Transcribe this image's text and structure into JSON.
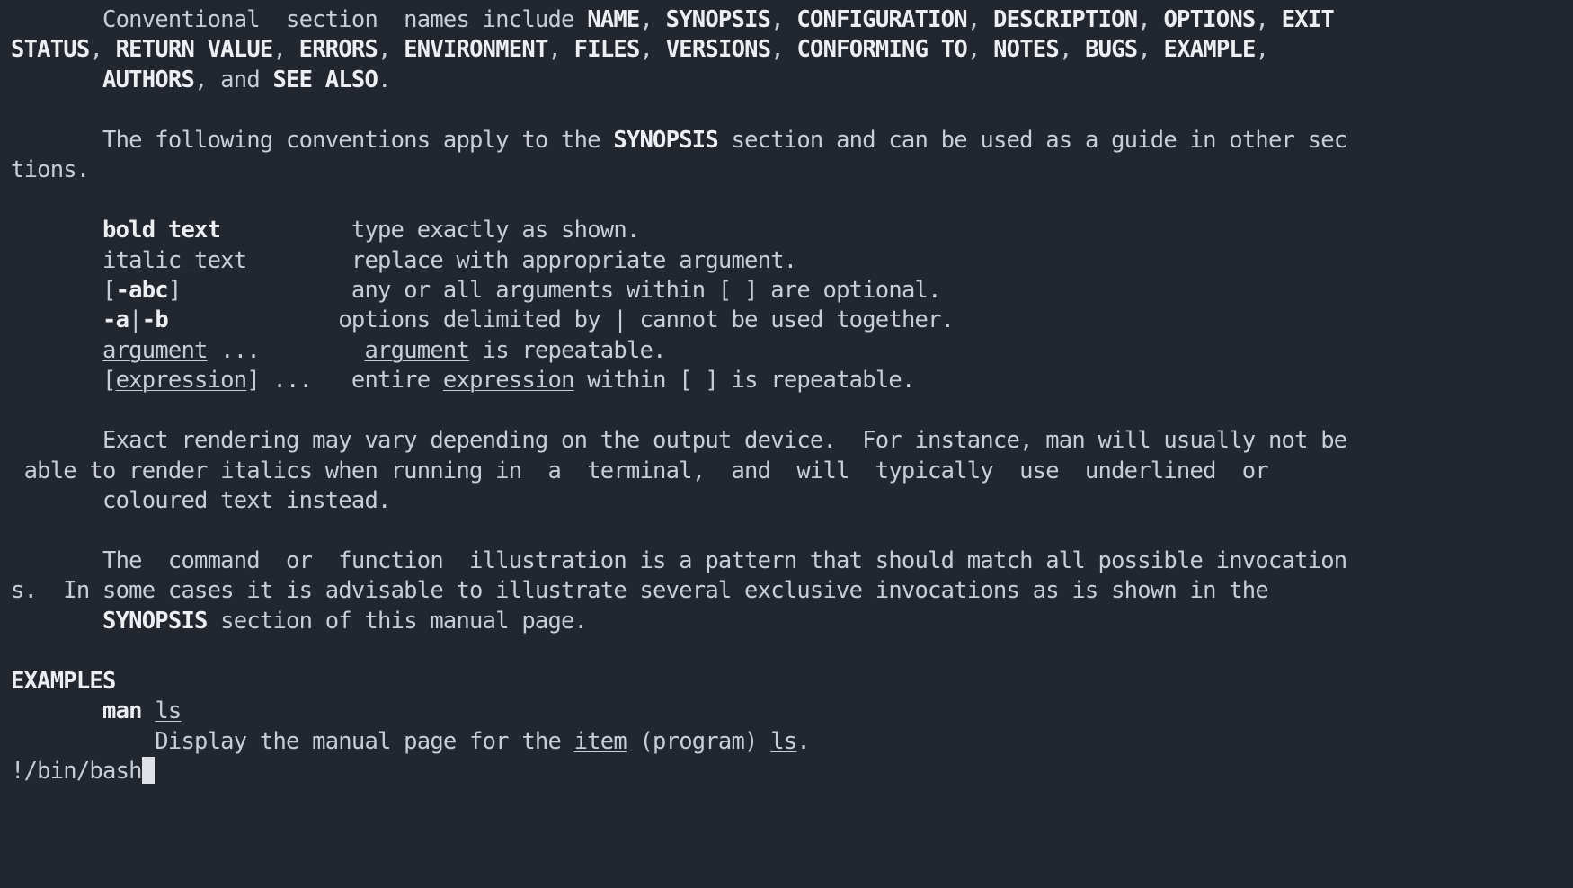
{
  "terminal": {
    "background_color": "#22262e",
    "foreground_color": "#c9cdd5",
    "bold_color": "#eceef2",
    "cursor_color": "#dfe1e6",
    "title": "man man"
  },
  "lines": [
    {
      "id": "conventional-section-names-1",
      "segments": [
        {
          "style": "normal",
          "text": "       Conventional  section  names include "
        },
        {
          "style": "bold",
          "text": "NAME"
        },
        {
          "style": "normal",
          "text": ", "
        },
        {
          "style": "bold",
          "text": "SYNOPSIS"
        },
        {
          "style": "normal",
          "text": ", "
        },
        {
          "style": "bold",
          "text": "CONFIGURATION"
        },
        {
          "style": "normal",
          "text": ", "
        },
        {
          "style": "bold",
          "text": "DESCRIPTION"
        },
        {
          "style": "normal",
          "text": ", "
        },
        {
          "style": "bold",
          "text": "OPTIONS"
        },
        {
          "style": "normal",
          "text": ", "
        },
        {
          "style": "bold",
          "text": "EXIT"
        }
      ]
    },
    {
      "id": "conventional-section-names-2",
      "segments": [
        {
          "style": "bold",
          "text": "STATUS"
        },
        {
          "style": "normal",
          "text": ", "
        },
        {
          "style": "bold",
          "text": "RETURN VALUE"
        },
        {
          "style": "normal",
          "text": ", "
        },
        {
          "style": "bold",
          "text": "ERRORS"
        },
        {
          "style": "normal",
          "text": ", "
        },
        {
          "style": "bold",
          "text": "ENVIRONMENT"
        },
        {
          "style": "normal",
          "text": ", "
        },
        {
          "style": "bold",
          "text": "FILES"
        },
        {
          "style": "normal",
          "text": ", "
        },
        {
          "style": "bold",
          "text": "VERSIONS"
        },
        {
          "style": "normal",
          "text": ", "
        },
        {
          "style": "bold",
          "text": "CONFORMING TO"
        },
        {
          "style": "normal",
          "text": ", "
        },
        {
          "style": "bold",
          "text": "NOTES"
        },
        {
          "style": "normal",
          "text": ", "
        },
        {
          "style": "bold",
          "text": "BUGS"
        },
        {
          "style": "normal",
          "text": ", "
        },
        {
          "style": "bold",
          "text": "EXAMPLE"
        },
        {
          "style": "normal",
          "text": ","
        }
      ]
    },
    {
      "id": "conventional-section-names-3",
      "segments": [
        {
          "style": "normal",
          "text": "       "
        },
        {
          "style": "bold",
          "text": "AUTHORS"
        },
        {
          "style": "normal",
          "text": ", and "
        },
        {
          "style": "bold",
          "text": "SEE ALSO"
        },
        {
          "style": "normal",
          "text": "."
        }
      ]
    },
    {
      "id": "blank-1",
      "segments": [
        {
          "style": "normal",
          "text": ""
        }
      ]
    },
    {
      "id": "conventions-intro-1",
      "segments": [
        {
          "style": "normal",
          "text": "       The following conventions apply to the "
        },
        {
          "style": "bold",
          "text": "SYNOPSIS"
        },
        {
          "style": "normal",
          "text": " section and can be used as a guide in other sec"
        }
      ]
    },
    {
      "id": "conventions-intro-2",
      "segments": [
        {
          "style": "normal",
          "text": "tions."
        }
      ]
    },
    {
      "id": "blank-2",
      "segments": [
        {
          "style": "normal",
          "text": ""
        }
      ]
    },
    {
      "id": "convention-bold-text",
      "segments": [
        {
          "style": "normal",
          "text": "       "
        },
        {
          "style": "bold",
          "text": "bold text"
        },
        {
          "style": "normal",
          "text": "          type exactly as shown."
        }
      ]
    },
    {
      "id": "convention-italic-text",
      "segments": [
        {
          "style": "normal",
          "text": "       "
        },
        {
          "style": "underline",
          "text": "italic text"
        },
        {
          "style": "normal",
          "text": "        replace with appropriate argument."
        }
      ]
    },
    {
      "id": "convention-optional-args",
      "segments": [
        {
          "style": "normal",
          "text": "       ["
        },
        {
          "style": "bold",
          "text": "-abc"
        },
        {
          "style": "normal",
          "text": "]             any or all arguments within [ ] are optional."
        }
      ]
    },
    {
      "id": "convention-delimited-options",
      "segments": [
        {
          "style": "normal",
          "text": "       "
        },
        {
          "style": "bold",
          "text": "-a"
        },
        {
          "style": "normal",
          "text": "|"
        },
        {
          "style": "bold",
          "text": "-b"
        },
        {
          "style": "normal",
          "text": "             options delimited by | cannot be used together."
        }
      ]
    },
    {
      "id": "convention-repeatable-argument",
      "segments": [
        {
          "style": "normal",
          "text": "       "
        },
        {
          "style": "underline",
          "text": "argument"
        },
        {
          "style": "normal",
          "text": " ...        "
        },
        {
          "style": "underline",
          "text": "argument"
        },
        {
          "style": "normal",
          "text": " is repeatable."
        }
      ]
    },
    {
      "id": "convention-repeatable-expression",
      "segments": [
        {
          "style": "normal",
          "text": "       ["
        },
        {
          "style": "underline",
          "text": "expression"
        },
        {
          "style": "normal",
          "text": "] ...   entire "
        },
        {
          "style": "underline",
          "text": "expression"
        },
        {
          "style": "normal",
          "text": " within [ ] is repeatable."
        }
      ]
    },
    {
      "id": "blank-3",
      "segments": [
        {
          "style": "normal",
          "text": ""
        }
      ]
    },
    {
      "id": "exact-rendering-1",
      "segments": [
        {
          "style": "normal",
          "text": "       Exact rendering may vary depending on the output device.  For instance, man will usually not be"
        }
      ]
    },
    {
      "id": "exact-rendering-2",
      "segments": [
        {
          "style": "normal",
          "text": " able to render italics when running in  a  terminal,  and  will  typically  use  underlined  or"
        }
      ]
    },
    {
      "id": "exact-rendering-3",
      "segments": [
        {
          "style": "normal",
          "text": "       coloured text instead."
        }
      ]
    },
    {
      "id": "blank-4",
      "segments": [
        {
          "style": "normal",
          "text": ""
        }
      ]
    },
    {
      "id": "command-illustration-1",
      "segments": [
        {
          "style": "normal",
          "text": "       The  command  or  function  illustration is a pattern that should match all possible invocation"
        }
      ]
    },
    {
      "id": "command-illustration-2",
      "segments": [
        {
          "style": "normal",
          "text": "s.  In some cases it is advisable to illustrate several exclusive invocations as is shown in the"
        }
      ]
    },
    {
      "id": "command-illustration-3",
      "segments": [
        {
          "style": "normal",
          "text": "       "
        },
        {
          "style": "bold",
          "text": "SYNOPSIS"
        },
        {
          "style": "normal",
          "text": " section of this manual page."
        }
      ]
    },
    {
      "id": "blank-5",
      "segments": [
        {
          "style": "normal",
          "text": ""
        }
      ]
    },
    {
      "id": "examples-heading",
      "segments": [
        {
          "style": "bold",
          "text": "EXAMPLES"
        }
      ]
    },
    {
      "id": "example-man-ls",
      "segments": [
        {
          "style": "normal",
          "text": "       "
        },
        {
          "style": "bold",
          "text": "man "
        },
        {
          "style": "underline",
          "text": "ls"
        }
      ]
    },
    {
      "id": "example-man-ls-desc",
      "segments": [
        {
          "style": "normal",
          "text": "           Display the manual page for the "
        },
        {
          "style": "underline",
          "text": "item"
        },
        {
          "style": "normal",
          "text": " (program) "
        },
        {
          "style": "underline",
          "text": "ls"
        },
        {
          "style": "normal",
          "text": "."
        }
      ]
    }
  ],
  "prompt": {
    "text": "!/bin/bash",
    "cursor": "block"
  }
}
